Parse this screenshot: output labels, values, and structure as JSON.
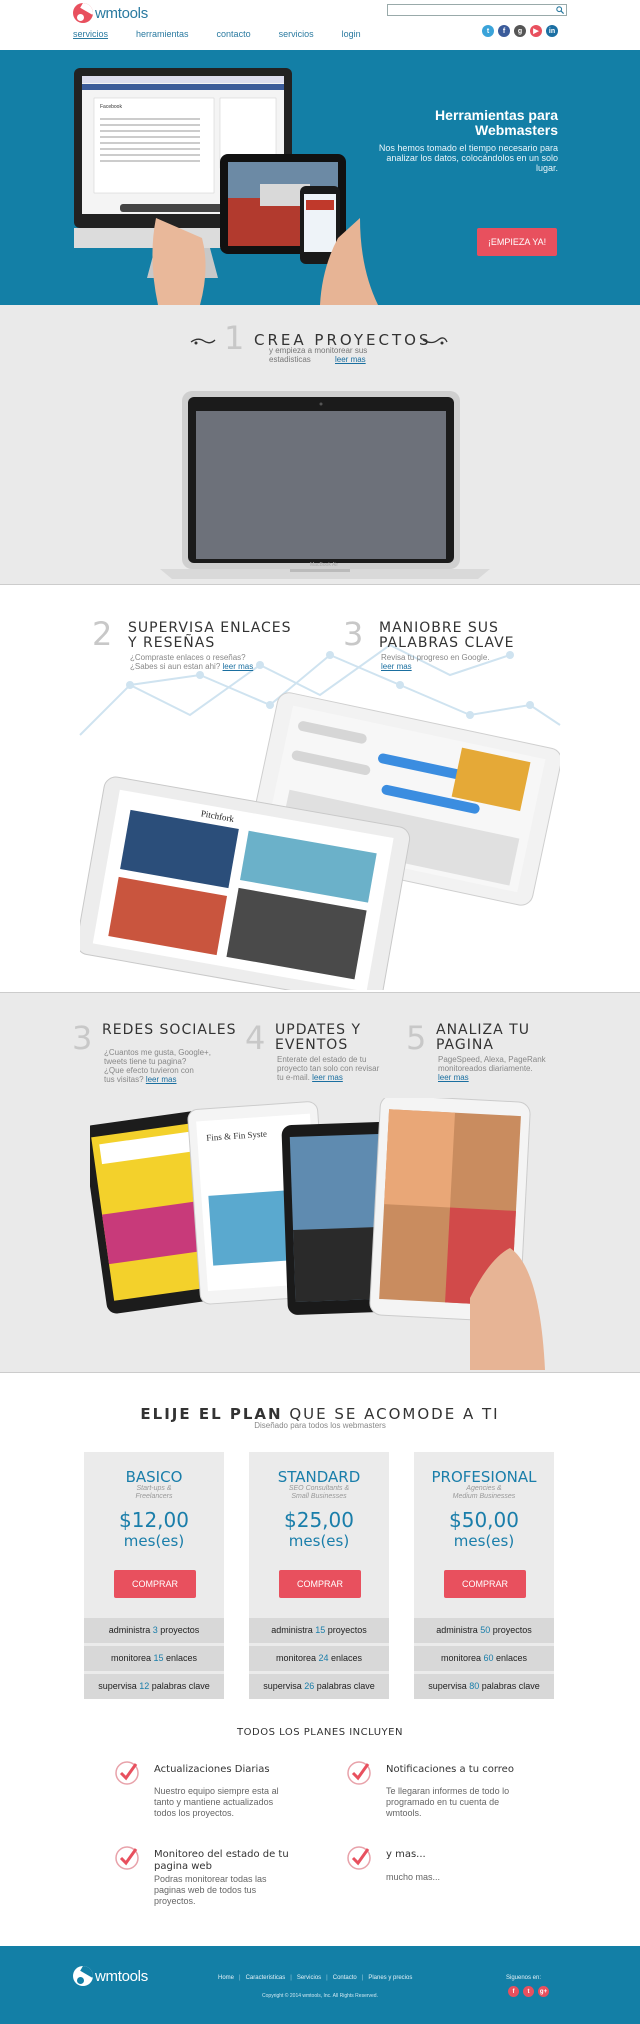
{
  "brand": {
    "name": "wmtools"
  },
  "search": {
    "placeholder": ""
  },
  "nav": {
    "items": [
      "servicios",
      "herramientas",
      "contacto",
      "servicios",
      "login"
    ],
    "active": 0
  },
  "socials": [
    {
      "icon": "twitter-icon",
      "glyph": "t",
      "color": "#3aa3d9"
    },
    {
      "icon": "facebook-icon",
      "glyph": "f",
      "color": "#3b5b9a"
    },
    {
      "icon": "github-icon",
      "glyph": "g",
      "color": "#555555"
    },
    {
      "icon": "youtube-icon",
      "glyph": "▶",
      "color": "#e8505e"
    },
    {
      "icon": "linkedin-icon",
      "glyph": "in",
      "color": "#1b6fa3"
    }
  ],
  "hero": {
    "title": "Herramientas para Webmasters",
    "text": "Nos hemos tomado el tiempo necesario para analizar los datos, colocándolos en un solo lugar.",
    "cta": "¡EMPIEZA YA!",
    "screen_title": "Facebook"
  },
  "features": {
    "f1": {
      "num": "1",
      "title": "CREA PROYECTOS",
      "sub": "y empieza a monitorear sus estadisticas",
      "link": "leer mas",
      "device_label": "MacBook Air"
    },
    "f2": {
      "num": "2",
      "title1": "SUPERVISA ENLACES",
      "title2": "Y RESEÑAS",
      "sub1": "¿Compraste enlaces o reseñas?",
      "sub2": "¿Sabes si aun estan ahi?",
      "link": "leer mas",
      "magazine": "Pitchfork"
    },
    "f3": {
      "num": "3",
      "title1": "MANIOBRE SUS",
      "title2": "PALABRAS CLAVE",
      "sub1": "Revisa tu progreso en Google.",
      "link": "leer mas"
    },
    "f4": {
      "num": "3",
      "title": "REDES SOCIALES",
      "sub1": "¿Cuantos me gusta, Google+,",
      "sub2": "tweets tiene tu pagina?",
      "sub3": "¿Que efecto tuvieron con",
      "sub4": "tus visitas?",
      "link": "leer mas"
    },
    "f5": {
      "num": "4",
      "title1": "UPDATES Y",
      "title2": "EVENTOS",
      "sub1": "Enterate del estado de tu",
      "sub2": "proyecto tan solo con revisar",
      "sub3": "tu e-mail.",
      "link": "leer mas"
    },
    "f6": {
      "num": "5",
      "title1": "ANALIZA TU",
      "title2": "PAGINA",
      "sub1": "PageSpeed, Alexa, PageRank",
      "sub2": "monitoreados diariamente.",
      "link": "leer mas",
      "book": "Fins & Fin Syste"
    }
  },
  "plans": {
    "heading_bold": "ELIJE EL PLAN",
    "heading_rest": "QUE SE ACOMODE A TI",
    "subheading": "Diseñado para todos los webmasters",
    "items": [
      {
        "name": "BASICO",
        "for1": "Start-ups &",
        "for2": "Freelancers",
        "price": "$12,00",
        "per": "mes(es)",
        "button": "COMPRAR",
        "rows": [
          {
            "pre": "administra ",
            "n": "3",
            "post": " proyectos"
          },
          {
            "pre": "monitorea ",
            "n": "15",
            "post": " enlaces"
          },
          {
            "pre": "supervisa ",
            "n": "12",
            "post": " palabras clave"
          }
        ]
      },
      {
        "name": "STANDARD",
        "for1": "SEO Consultants &",
        "for2": "Small Businesses",
        "price": "$25,00",
        "per": "mes(es)",
        "button": "COMPRAR",
        "rows": [
          {
            "pre": "administra ",
            "n": "15",
            "post": " proyectos"
          },
          {
            "pre": "monitorea ",
            "n": "24",
            "post": " enlaces"
          },
          {
            "pre": "supervisa ",
            "n": "26",
            "post": " palabras clave"
          }
        ]
      },
      {
        "name": "PROFESIONAL",
        "for1": "Agencies &",
        "for2": "Medium Businesses",
        "price": "$50,00",
        "per": "mes(es)",
        "button": "COMPRAR",
        "rows": [
          {
            "pre": "administra ",
            "n": "50",
            "post": " proyectos"
          },
          {
            "pre": "monitorea ",
            "n": "60",
            "post": " enlaces"
          },
          {
            "pre": "supervisa ",
            "n": "80",
            "post": " palabras clave"
          }
        ]
      }
    ]
  },
  "included": {
    "title": "TODOS LOS PLANES INCLUYEN",
    "items": [
      {
        "title": "Actualizaciones Diarias",
        "t1": "Nuestro equipo siempre esta al",
        "t2": "tanto y mantiene actualizados",
        "t3": "todos los proyectos."
      },
      {
        "title": "Notificaciones a tu correo",
        "t1": "Te llegaran informes de todo lo",
        "t2": "programado en tu cuenta de",
        "t3": "wmtools."
      },
      {
        "title1": "Monitoreo del estado de tu",
        "title2": "pagina web",
        "t1": "Podras monitorear todas las",
        "t2": "paginas web de todos tus",
        "t3": "proyectos."
      },
      {
        "title": "y mas...",
        "t1": "mucho mas..."
      }
    ]
  },
  "footer": {
    "links": [
      "Home",
      "Caracteristicas",
      "Servicios",
      "Contacto",
      "Planes y precios"
    ],
    "copyright": "Copyright © 2014 wmtools, Inc. All Rights Reserved.",
    "follow": "Siguenos en:",
    "socials": [
      {
        "icon": "facebook-icon",
        "glyph": "f"
      },
      {
        "icon": "twitter-icon",
        "glyph": "t"
      },
      {
        "icon": "googleplus-icon",
        "glyph": "g+"
      }
    ]
  }
}
